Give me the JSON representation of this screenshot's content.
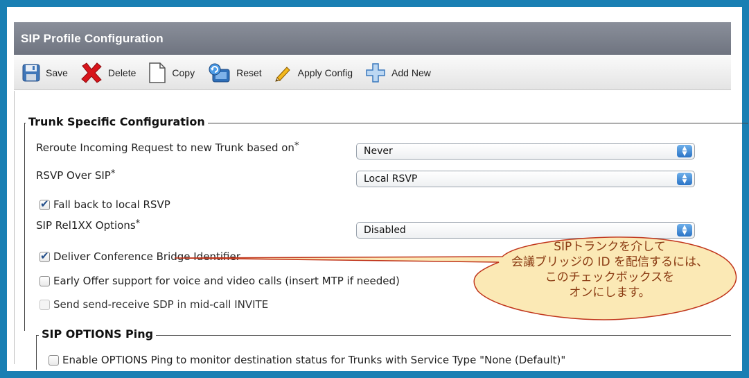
{
  "page": {
    "title": "SIP Profile Configuration"
  },
  "toolbar": {
    "save_label": "Save",
    "delete_label": "Delete",
    "copy_label": "Copy",
    "reset_label": "Reset",
    "apply_label": "Apply Config",
    "add_new_label": "Add New"
  },
  "trunk": {
    "legend": "Trunk Specific Configuration",
    "reroute_label": "Reroute Incoming Request to new Trunk based on",
    "reroute_value": "Never",
    "rsvp_label": "RSVP Over SIP",
    "rsvp_value": "Local RSVP",
    "fallback_label": "Fall back to local RSVP",
    "fallback_checked": true,
    "rel1xx_label": "SIP Rel1XX Options",
    "rel1xx_value": "Disabled",
    "deliver_label": "Deliver Conference Bridge Identifier",
    "deliver_checked": true,
    "early_offer_label": "Early Offer support for voice and video calls (insert MTP if needed)",
    "early_offer_checked": false,
    "send_receive_label": "Send send-receive SDP in mid-call INVITE",
    "send_receive_checked": false,
    "required_mark": "*"
  },
  "options_ping": {
    "legend": "SIP OPTIONS Ping",
    "enable_label": "Enable OPTIONS Ping to monitor destination status for Trunks with Service Type \"None (Default)\"",
    "enable_checked": false
  },
  "callout": {
    "line1": "SIPトランクを介して",
    "line2": "会議ブリッジの ID を配信するには、",
    "line3": "このチェックボックスを",
    "line4": "オンにします。",
    "fill_color": "#fbe9b5",
    "border_color": "#c0341a"
  },
  "icons": {
    "save": "floppy-disk-icon",
    "delete": "red-x-icon",
    "copy": "document-icon",
    "reset": "reset-icon",
    "apply": "pencil-icon",
    "add": "plus-icon"
  },
  "colors": {
    "frame_border": "#1a7fb3",
    "title_bar": "#7a7f8a",
    "select_arrow": "#2b74c6"
  }
}
